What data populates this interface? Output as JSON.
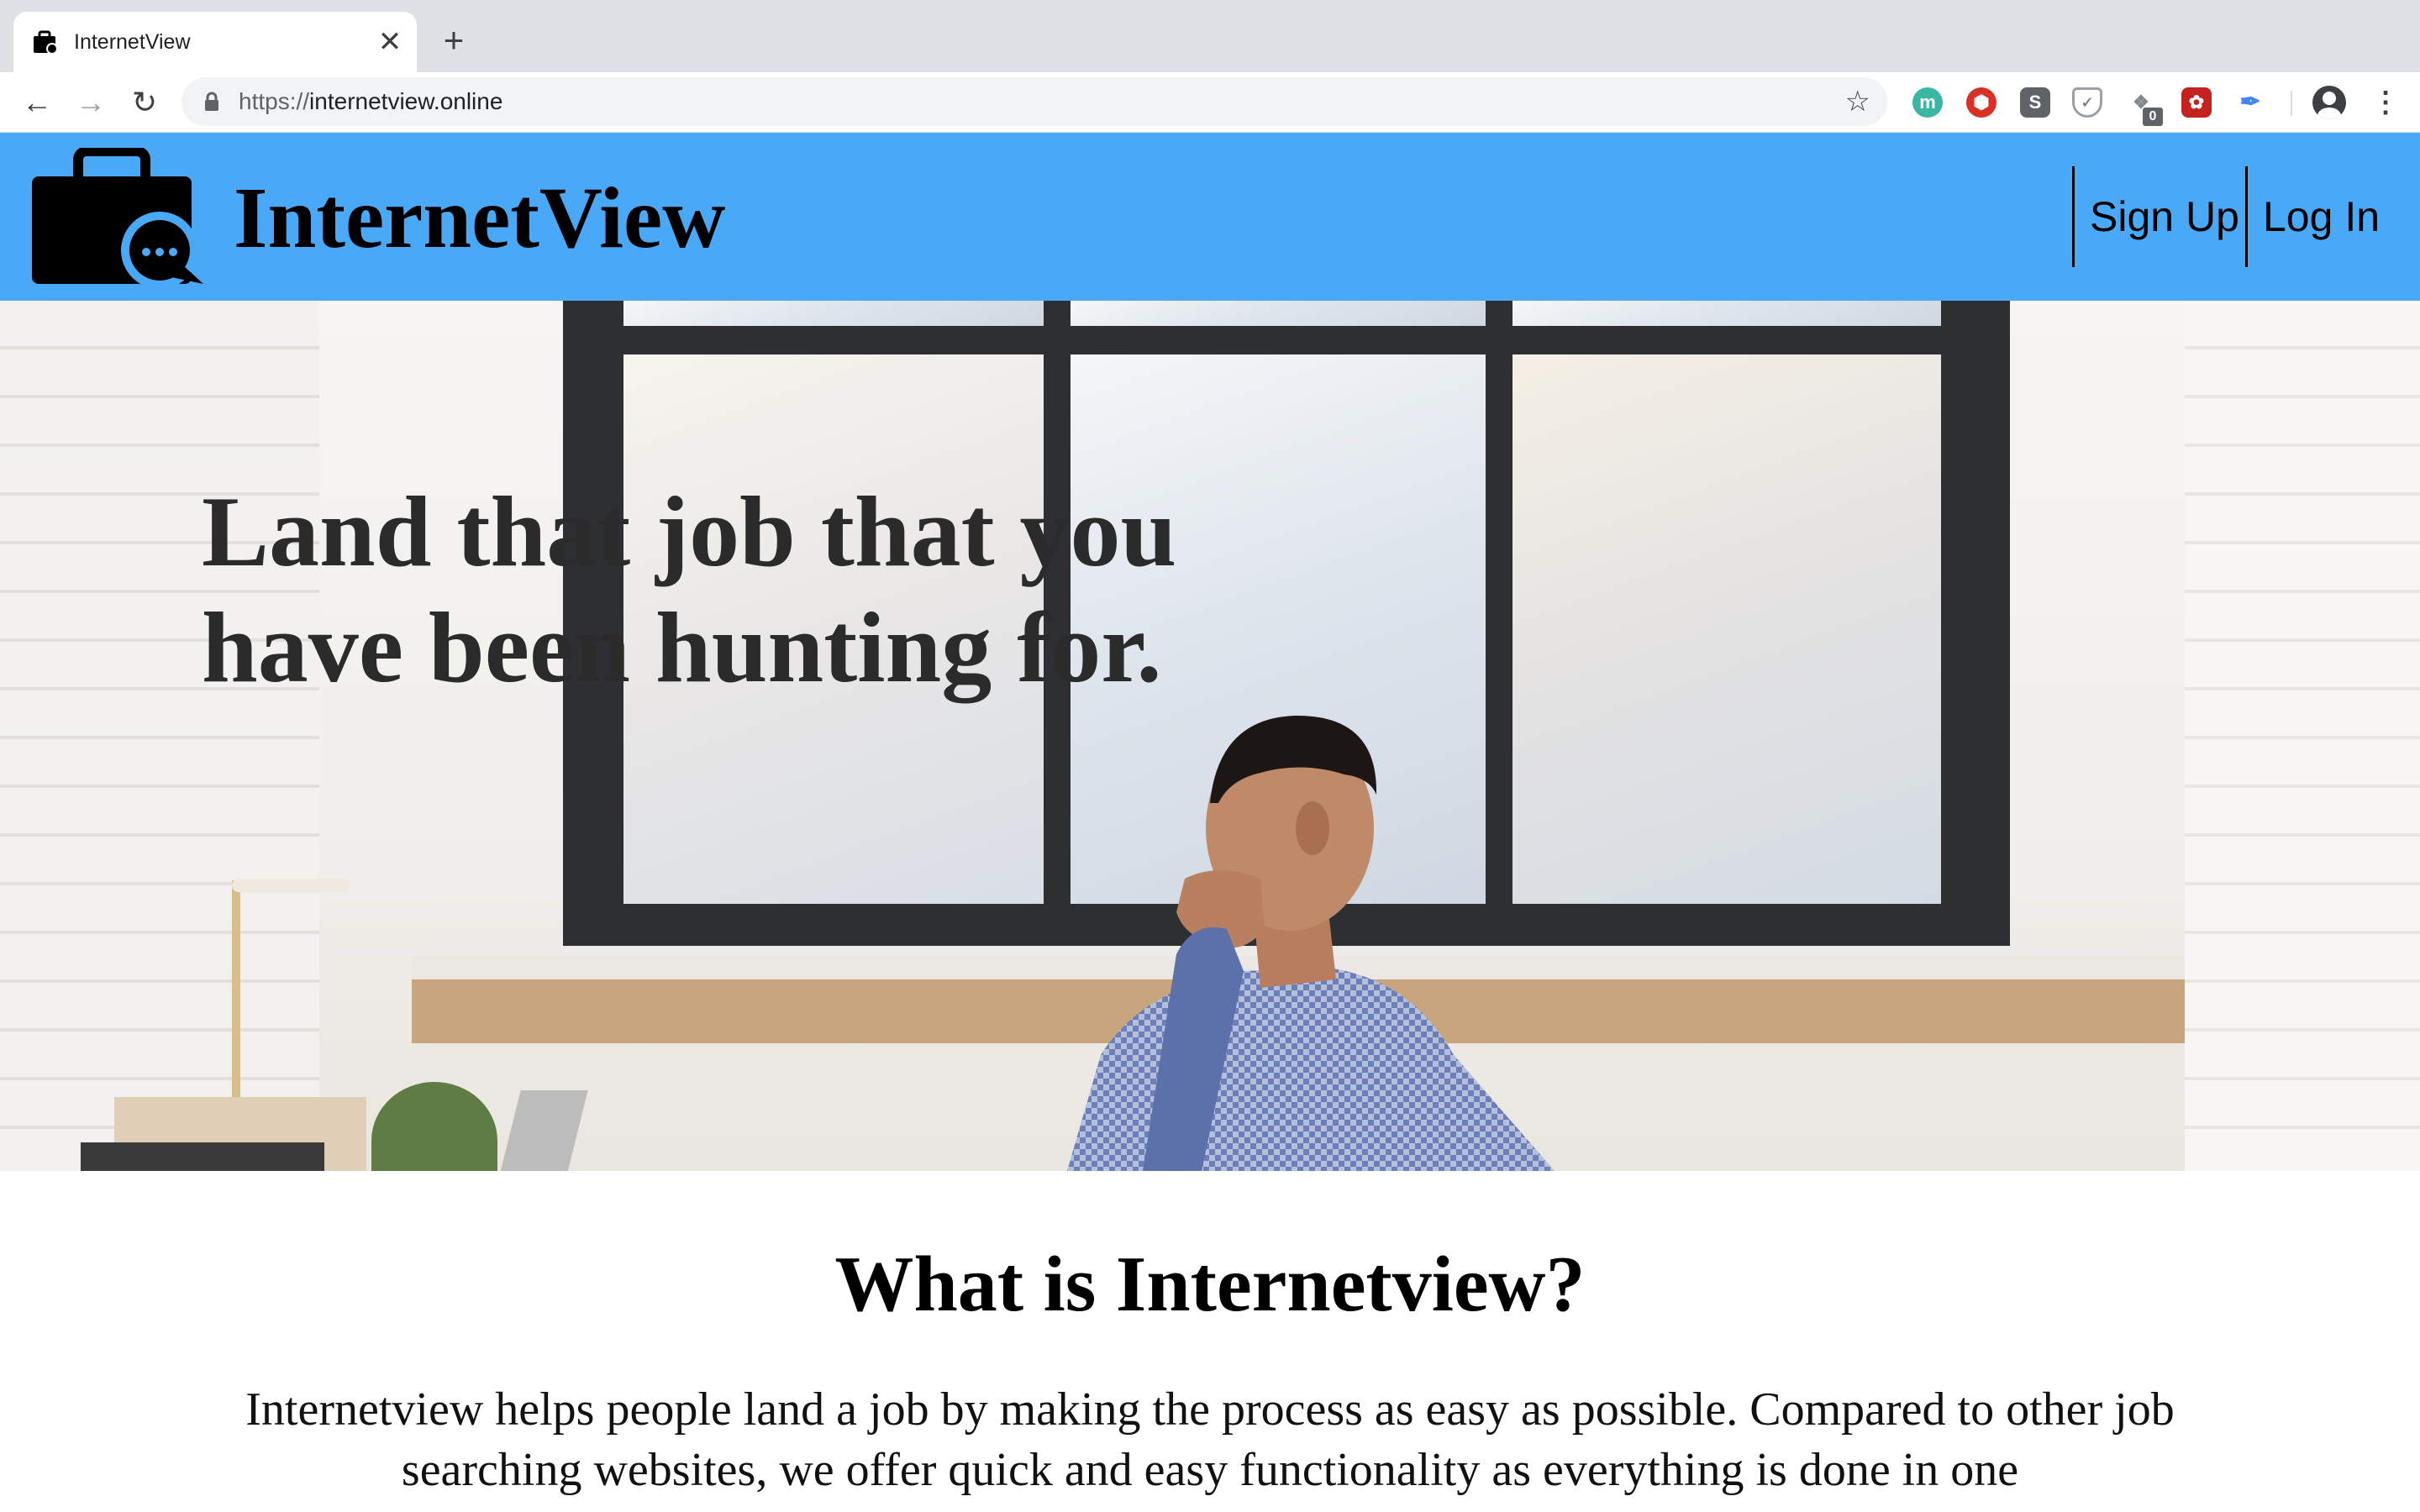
{
  "browser": {
    "tab_title": "InternetView",
    "tab_close": "✕",
    "new_tab": "+",
    "nav_back": "←",
    "nav_forward": "→",
    "nav_reload": "↻",
    "url_scheme": "https://",
    "url_host": "internetview.online",
    "bookmark": "☆",
    "extensions": [
      {
        "name": "extension-m",
        "glyph": "m"
      },
      {
        "name": "extension-shield-red",
        "glyph": "⬢"
      },
      {
        "name": "extension-s",
        "glyph": "S"
      },
      {
        "name": "extension-shield",
        "glyph": "✓"
      },
      {
        "name": "extension-puzzle",
        "glyph": "❖",
        "badge": "0"
      },
      {
        "name": "extension-red",
        "glyph": "✿"
      },
      {
        "name": "extension-feather",
        "glyph": "✒"
      }
    ],
    "menu": "⋮"
  },
  "site": {
    "brand": "InternetView",
    "nav": {
      "signup": "Sign Up",
      "login": "Log In"
    },
    "colors": {
      "header": "#4aa9f7"
    }
  },
  "hero": {
    "title": "Land that job that you have been hunting for."
  },
  "about": {
    "title": "What is Internetview?",
    "body": "Internetview helps people land a job by making the process as easy as possible. Compared to other job searching websites, we offer quick and easy functionality as everything is done in one"
  }
}
